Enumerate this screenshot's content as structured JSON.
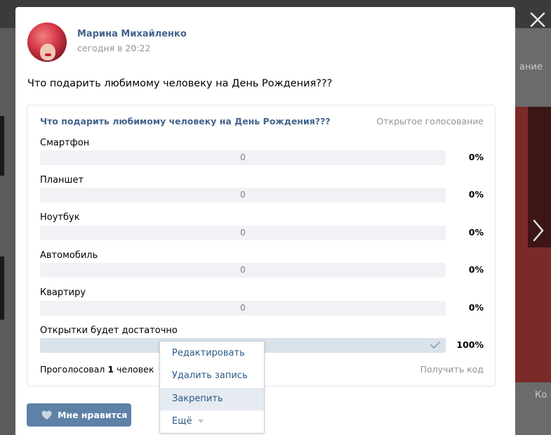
{
  "background": {
    "right_text_top": "ание",
    "right_text_bottom": "Ко"
  },
  "post": {
    "author": "Марина Михайленко",
    "date": "сегодня в 20:22",
    "text": "Что подарить любимому человеку на День Рождения???"
  },
  "poll": {
    "title": "Что подарить любимому человеку на День Рождения???",
    "type": "Открытое голосование",
    "answers": [
      {
        "label": "Смартфон",
        "count": "0",
        "percent": "0%",
        "fraction": 0
      },
      {
        "label": "Планшет",
        "count": "0",
        "percent": "0%",
        "fraction": 0
      },
      {
        "label": "Ноутбук",
        "count": "0",
        "percent": "0%",
        "fraction": 0
      },
      {
        "label": "Автомобиль",
        "count": "0",
        "percent": "0%",
        "fraction": 0
      },
      {
        "label": "Квартиру",
        "count": "0",
        "percent": "0%",
        "fraction": 0
      },
      {
        "label": "Открытки будет достаточно",
        "count": "",
        "percent": "100%",
        "fraction": 1,
        "voted": true
      }
    ],
    "voters_prefix": "Проголосовал",
    "voters_count": "1",
    "voters_suffix": "человек",
    "get_code": "Получить код"
  },
  "actions": {
    "like_label": "Мне нравится"
  },
  "menu": {
    "items": [
      {
        "label": "Редактировать"
      },
      {
        "label": "Удалить запись"
      },
      {
        "label": "Закрепить"
      },
      {
        "label": "Ещё"
      }
    ]
  },
  "colors": {
    "link": "#42648b",
    "button": "#5e81a8",
    "menu_text": "#2a5885",
    "muted": "#939393"
  },
  "icons": {
    "close": "close-icon",
    "next": "chevron-right-icon",
    "like": "heart-icon",
    "check": "check-icon",
    "more": "chevron-down-icon"
  }
}
